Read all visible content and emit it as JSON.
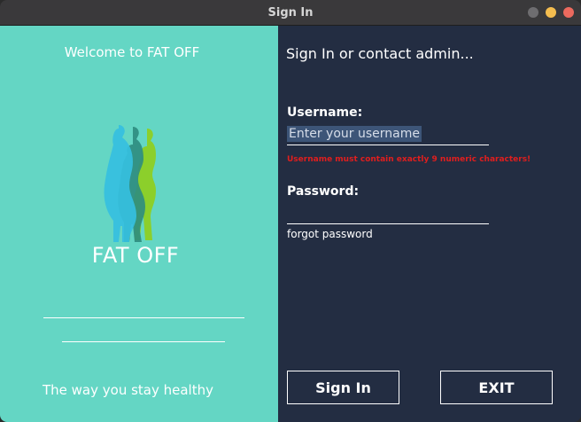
{
  "window": {
    "title": "Sign In"
  },
  "left_panel": {
    "welcome": "Welcome to FAT OFF",
    "brand": "FAT OFF",
    "tagline": "The way you stay healthy",
    "logo_icon": "silhouettes-logo-icon"
  },
  "right_panel": {
    "heading": "Sign In or contact admin...",
    "username": {
      "label": "Username:",
      "value": "Enter your username",
      "error": "Username must contain exactly 9 numeric characters!"
    },
    "password": {
      "label": "Password:",
      "value": ""
    },
    "forgot_link": "forgot password",
    "signin_button": "Sign In",
    "exit_button": "EXIT"
  },
  "colors": {
    "left_bg": "#64d6c4",
    "right_bg": "#232d42",
    "error": "#e01e1e",
    "selection": "#3d5578"
  }
}
